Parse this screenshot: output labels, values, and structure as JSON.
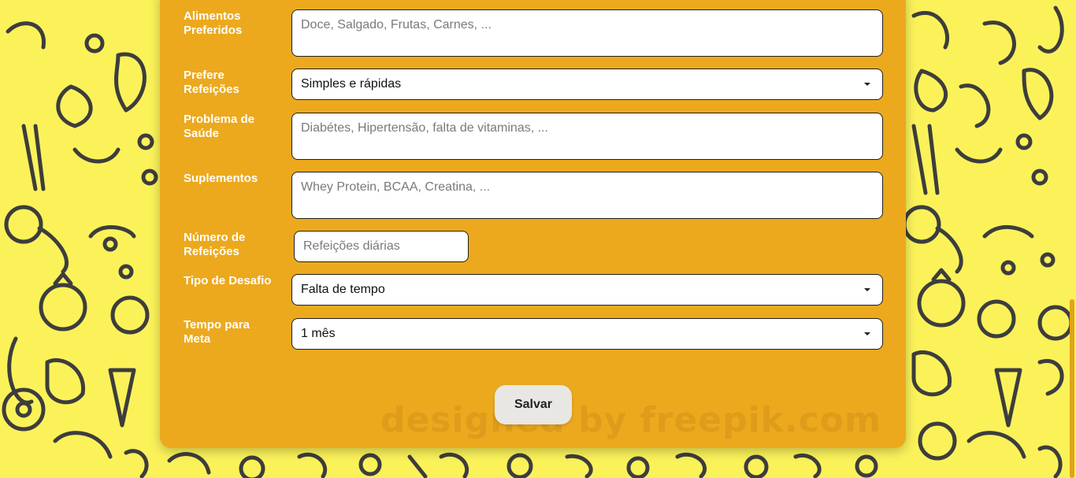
{
  "form": {
    "alimentos": {
      "label": "Alimentos Preferidos",
      "placeholder": "Doce, Salgado, Frutas, Carnes, ..."
    },
    "refeicoes": {
      "label": "Prefere Refeições",
      "value": "Simples e rápidas"
    },
    "saude": {
      "label": "Problema de Saúde",
      "placeholder": "Diabétes, Hipertensão, falta de vitaminas, ..."
    },
    "suplementos": {
      "label": "Suplementos",
      "placeholder": "Whey Protein, BCAA, Creatina, ..."
    },
    "numero_refeicoes": {
      "label": "Número de Refeições",
      "placeholder": "Refeições diárias"
    },
    "desafio": {
      "label": "Tipo de Desafio",
      "value": "Falta de tempo"
    },
    "tempo_meta": {
      "label": "Tempo para Meta",
      "value": "1 mês"
    },
    "save_label": "Salvar"
  },
  "watermark": "designed by freepik.com",
  "colors": {
    "background": "#fbf25a",
    "card": "#eca91e",
    "doodle": "#3d3d3d",
    "button": "#e9e7e4"
  }
}
